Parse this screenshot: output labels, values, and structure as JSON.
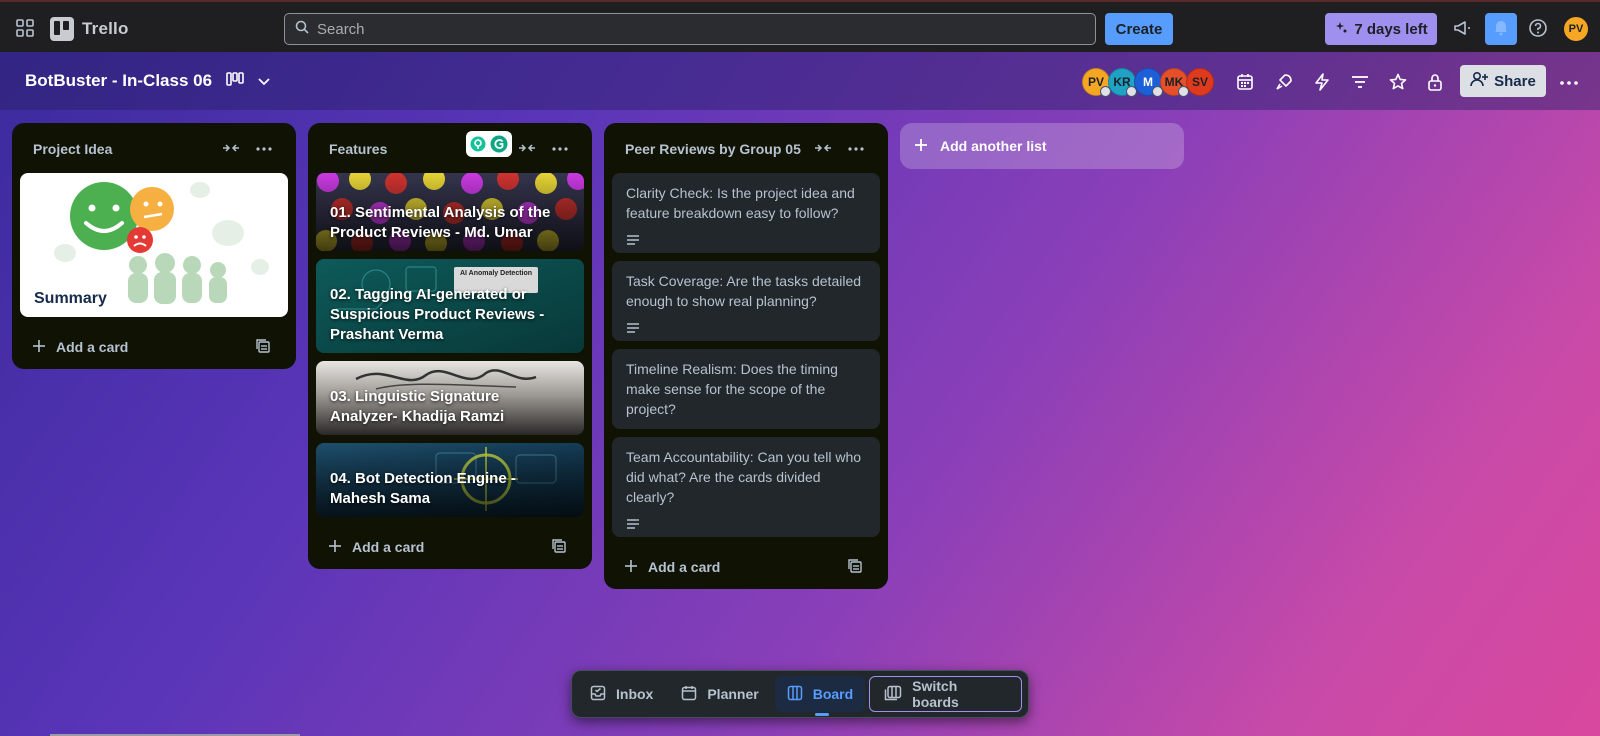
{
  "app": {
    "name": "Trello"
  },
  "topbar": {
    "search_placeholder": "Search",
    "create_label": "Create",
    "trial_label": "7 days left",
    "user_initials": "PV"
  },
  "board": {
    "title": "BotBuster - In-Class 06",
    "members": [
      {
        "initials": "PV",
        "color": "#f5a623"
      },
      {
        "initials": "KR",
        "color": "#1fa3c4"
      },
      {
        "initials": "M",
        "color": "#1d5fd6"
      },
      {
        "initials": "MK",
        "color": "#e5502a"
      },
      {
        "initials": "SV",
        "color": "#e03a1e"
      }
    ],
    "share_label": "Share"
  },
  "lists": [
    {
      "title": "Project Idea",
      "cards": [
        {
          "title": "Summary"
        }
      ],
      "add_card_label": "Add a card"
    },
    {
      "title": "Features",
      "cards": [
        {
          "title": "01. Sentimental Analysis of the Product Reviews - Md. Umar"
        },
        {
          "title": "02. Tagging AI-generated or Suspicious Product Reviews - Prashant Verma",
          "cover_text": "AI Anomaly Detection"
        },
        {
          "title": "03. Linguistic Signature Analyzer- Khadija Ramzi"
        },
        {
          "title": "04. Bot Detection Engine - Mahesh Sama"
        }
      ],
      "add_card_label": "Add a card"
    },
    {
      "title": "Peer Reviews by Group 05",
      "cards": [
        {
          "title": "Clarity Check: Is the project idea and feature breakdown easy to follow?"
        },
        {
          "title": "Task Coverage: Are the tasks detailed enough to show real planning?"
        },
        {
          "title": "Timeline Realism: Does the timing make sense for the scope of the project?"
        },
        {
          "title": "Team Accountability: Can you tell who did what? Are the cards divided clearly?"
        }
      ],
      "add_card_label": "Add a card"
    }
  ],
  "add_list_label": "Add another list",
  "bottom_nav": {
    "inbox": "Inbox",
    "planner": "Planner",
    "board": "Board",
    "switch_boards": "Switch boards"
  },
  "colors": {
    "accent": "#579dff",
    "trial": "#9f8fef",
    "list_bg": "#101204",
    "card_bg": "#22272b"
  }
}
